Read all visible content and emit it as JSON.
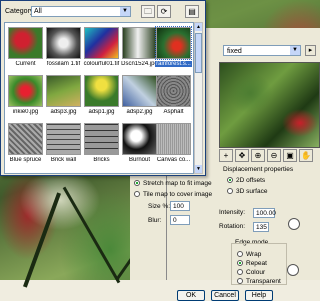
{
  "browser": {
    "category_label": "Category:",
    "category_value": "All",
    "thumbnails": [
      {
        "label": "Current"
      },
      {
        "label": "fossilam 1.tif"
      },
      {
        "label": "colourful01.tif"
      },
      {
        "label": "Dscn1524.jpg"
      },
      {
        "label": "rainforest.s..."
      },
      {
        "label": "inkie0.jpg"
      },
      {
        "label": "adsp3.jpg"
      },
      {
        "label": "adsp1.jpg"
      },
      {
        "label": "adsp2.jpg"
      },
      {
        "label": "Asphalt"
      },
      {
        "label": "Blue spruce"
      },
      {
        "label": "Brick wall"
      },
      {
        "label": "Bricks"
      },
      {
        "label": "Burnout"
      },
      {
        "label": "Canvas co..."
      }
    ]
  },
  "dialog": {
    "map_select_value": "fixed",
    "displacement_properties_label": "Displacement properties",
    "offsets_2d_label": "2D offsets",
    "surface_3d_label": "3D surface",
    "intensity_label": "Intensity:",
    "intensity_value": "100.00",
    "rotation_label": "Rotation:",
    "rotation_value": "135",
    "edge_mode_label": "Edge mode",
    "edge_wrap_label": "Wrap",
    "edge_repeat_label": "Repeat",
    "edge_color_label": "Colour",
    "edge_transparent_label": "Transparent",
    "stretch_label": "Stretch map to fit image",
    "tile_label": "Tile map to cover image",
    "size_label": "Size %:",
    "size_value": "100",
    "blur_label": "Blur:",
    "blur_value": "0",
    "ok_label": "OK",
    "cancel_label": "Cancel",
    "help_label": "Help"
  }
}
